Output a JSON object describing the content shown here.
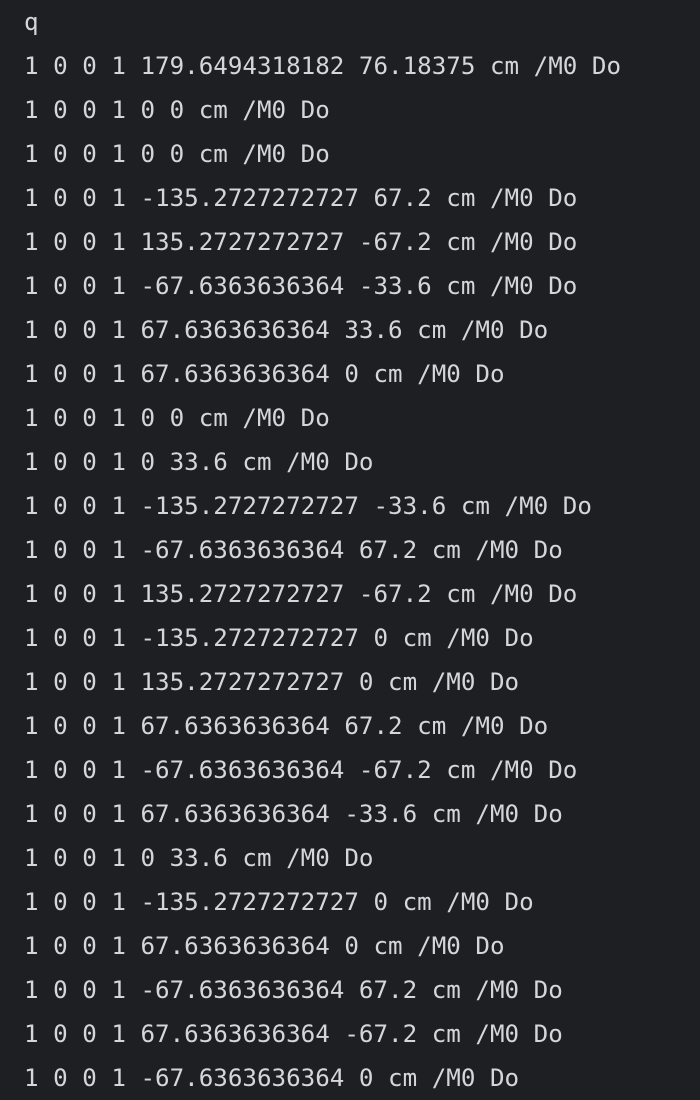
{
  "editor": {
    "lines": [
      "q",
      "1 0 0 1 179.6494318182 76.18375 cm /M0 Do",
      "1 0 0 1 0 0 cm /M0 Do",
      "1 0 0 1 0 0 cm /M0 Do",
      "1 0 0 1 -135.2727272727 67.2 cm /M0 Do",
      "1 0 0 1 135.2727272727 -67.2 cm /M0 Do",
      "1 0 0 1 -67.6363636364 -33.6 cm /M0 Do",
      "1 0 0 1 67.6363636364 33.6 cm /M0 Do",
      "1 0 0 1 67.6363636364 0 cm /M0 Do",
      "1 0 0 1 0 0 cm /M0 Do",
      "1 0 0 1 0 33.6 cm /M0 Do",
      "1 0 0 1 -135.2727272727 -33.6 cm /M0 Do",
      "1 0 0 1 -67.6363636364 67.2 cm /M0 Do",
      "1 0 0 1 135.2727272727 -67.2 cm /M0 Do",
      "1 0 0 1 -135.2727272727 0 cm /M0 Do",
      "1 0 0 1 135.2727272727 0 cm /M0 Do",
      "1 0 0 1 67.6363636364 67.2 cm /M0 Do",
      "1 0 0 1 -67.6363636364 -67.2 cm /M0 Do",
      "1 0 0 1 67.6363636364 -33.6 cm /M0 Do",
      "1 0 0 1 0 33.6 cm /M0 Do",
      "1 0 0 1 -135.2727272727 0 cm /M0 Do",
      "1 0 0 1 67.6363636364 0 cm /M0 Do",
      "1 0 0 1 -67.6363636364 67.2 cm /M0 Do",
      "1 0 0 1 67.6363636364 -67.2 cm /M0 Do",
      "1 0 0 1 -67.6363636364 0 cm /M0 Do"
    ]
  },
  "colors": {
    "background": "#1e1f22",
    "text": "#d4d6da"
  }
}
